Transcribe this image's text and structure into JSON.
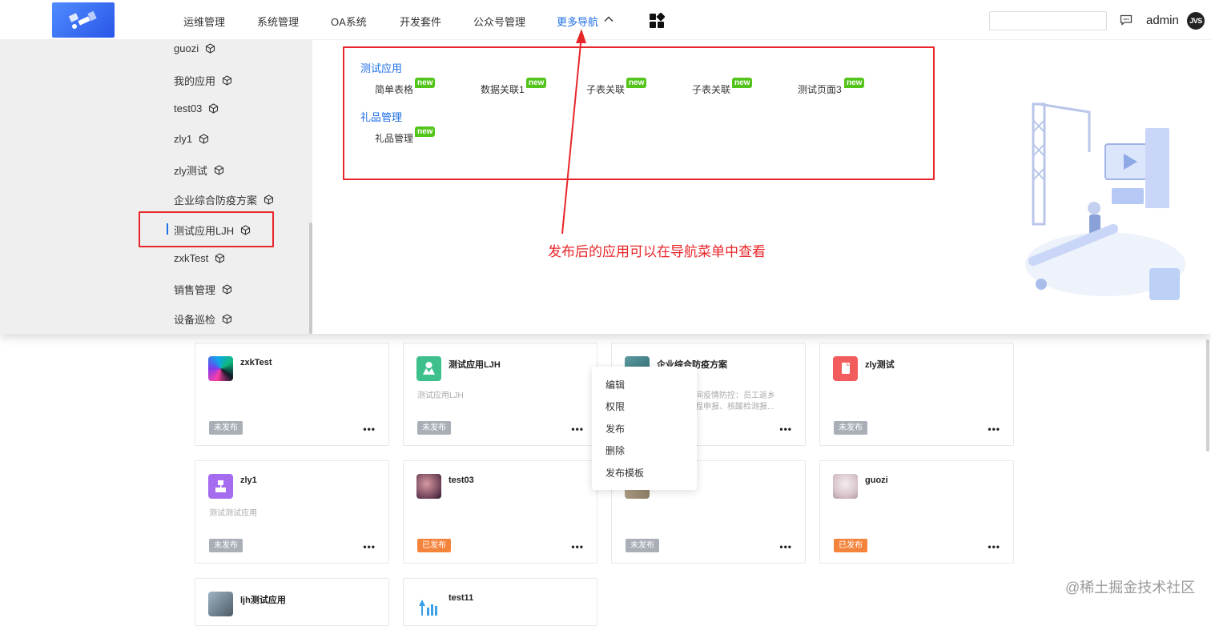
{
  "header": {
    "nav": [
      "运维管理",
      "系统管理",
      "OA系统",
      "开发套件",
      "公众号管理",
      "更多导航"
    ],
    "search_placeholder": "",
    "user": "admin",
    "avatar_text": "JVS"
  },
  "mega_menu": {
    "sidebar": [
      "guozi",
      "我的应用",
      "test03",
      "zly1",
      "zly测试",
      "企业综合防疫方案",
      "测试应用LJH",
      "zxkTest",
      "销售管理",
      "设备巡检"
    ],
    "selected": "测试应用LJH",
    "groups": [
      {
        "title": "测试应用",
        "apps": [
          {
            "name": "简单表格",
            "badge": "new"
          },
          {
            "name": "数据关联1",
            "badge": "new"
          },
          {
            "name": "子表关联",
            "badge": "new"
          },
          {
            "name": "子表关联",
            "badge": "new"
          },
          {
            "name": "测试页面3",
            "badge": "new"
          }
        ]
      },
      {
        "title": "礼品管理",
        "apps": [
          {
            "name": "礼品管理",
            "badge": "new"
          }
        ]
      }
    ]
  },
  "annotation": "发布后的应用可以在导航菜单中查看",
  "cards": [
    {
      "title": "zxkTest",
      "desc": "",
      "status": "未发布"
    },
    {
      "title": "测试应用LJH",
      "desc": "测试应用LJH",
      "status": "未发布"
    },
    {
      "title": "企业综合防疫方案",
      "desc_line1": "期间疫情防控：员工返乡",
      "desc_line2": "返程申报、核酸检测报...",
      "status": ""
    },
    {
      "title": "zly测试",
      "desc": "",
      "status": "未发布"
    },
    {
      "title": "zly1",
      "desc": "测试测试应用",
      "status": "未发布"
    },
    {
      "title": "test03",
      "desc": "",
      "status": "已发布"
    },
    {
      "title": "",
      "desc": "",
      "status": "未发布"
    },
    {
      "title": "guozi",
      "desc": "",
      "status": "已发布"
    },
    {
      "title": "ljh测试应用",
      "desc": "",
      "status": ""
    },
    {
      "title": "test11",
      "desc": "",
      "status": ""
    }
  ],
  "more_label": "•••",
  "context_menu": [
    "编辑",
    "权限",
    "发布",
    "删除",
    "发布模板"
  ],
  "watermark": "@稀土掘金技术社区",
  "colors": {
    "accent": "#1f6fe6",
    "annotation": "#e8262a",
    "new_badge": "#52c41a",
    "draft": "#a9aeb7",
    "published": "#f4833c"
  }
}
